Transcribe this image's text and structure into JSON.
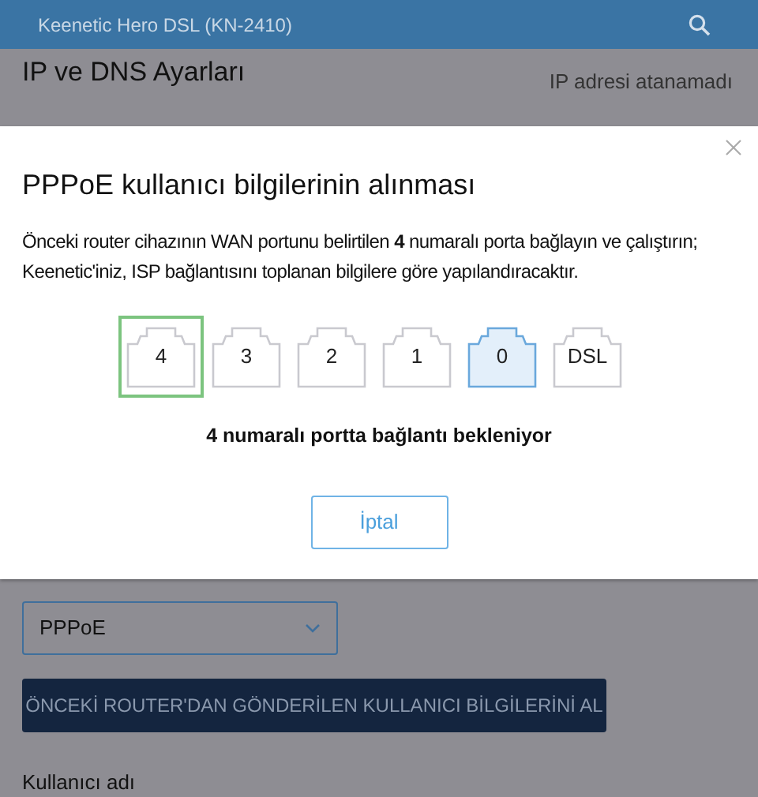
{
  "header": {
    "title": "Keenetic Hero DSL (KN-2410)"
  },
  "page": {
    "title": "IP ve DNS Ayarları",
    "status": "IP adresi atanamadı",
    "protocol_value": "PPPoE",
    "fetch_button": "ÖNCEKİ ROUTER'DAN GÖNDERİLEN KULLANICI BİLGİLERİNİ AL",
    "username_label": "Kullanıcı adı"
  },
  "dialog": {
    "title": "PPPoE kullanıcı bilgilerinin alınması",
    "text": "Önceki router cihazının WAN portunu belirtilen **4** numaralı porta bağlayın ve çalıştırın; Keenetic'iniz, ISP bağlantısını toplanan bilgilere göre yapılandıracaktır.",
    "ports": [
      {
        "label": "4",
        "selected": true,
        "highlighted": false
      },
      {
        "label": "3",
        "selected": false,
        "highlighted": false
      },
      {
        "label": "2",
        "selected": false,
        "highlighted": false
      },
      {
        "label": "1",
        "selected": false,
        "highlighted": false
      },
      {
        "label": "0",
        "selected": false,
        "highlighted": true
      },
      {
        "label": "DSL",
        "selected": false,
        "highlighted": false
      }
    ],
    "status": "4 numaralı portta bağlantı bekleniyor",
    "cancel_button": "İptal"
  }
}
